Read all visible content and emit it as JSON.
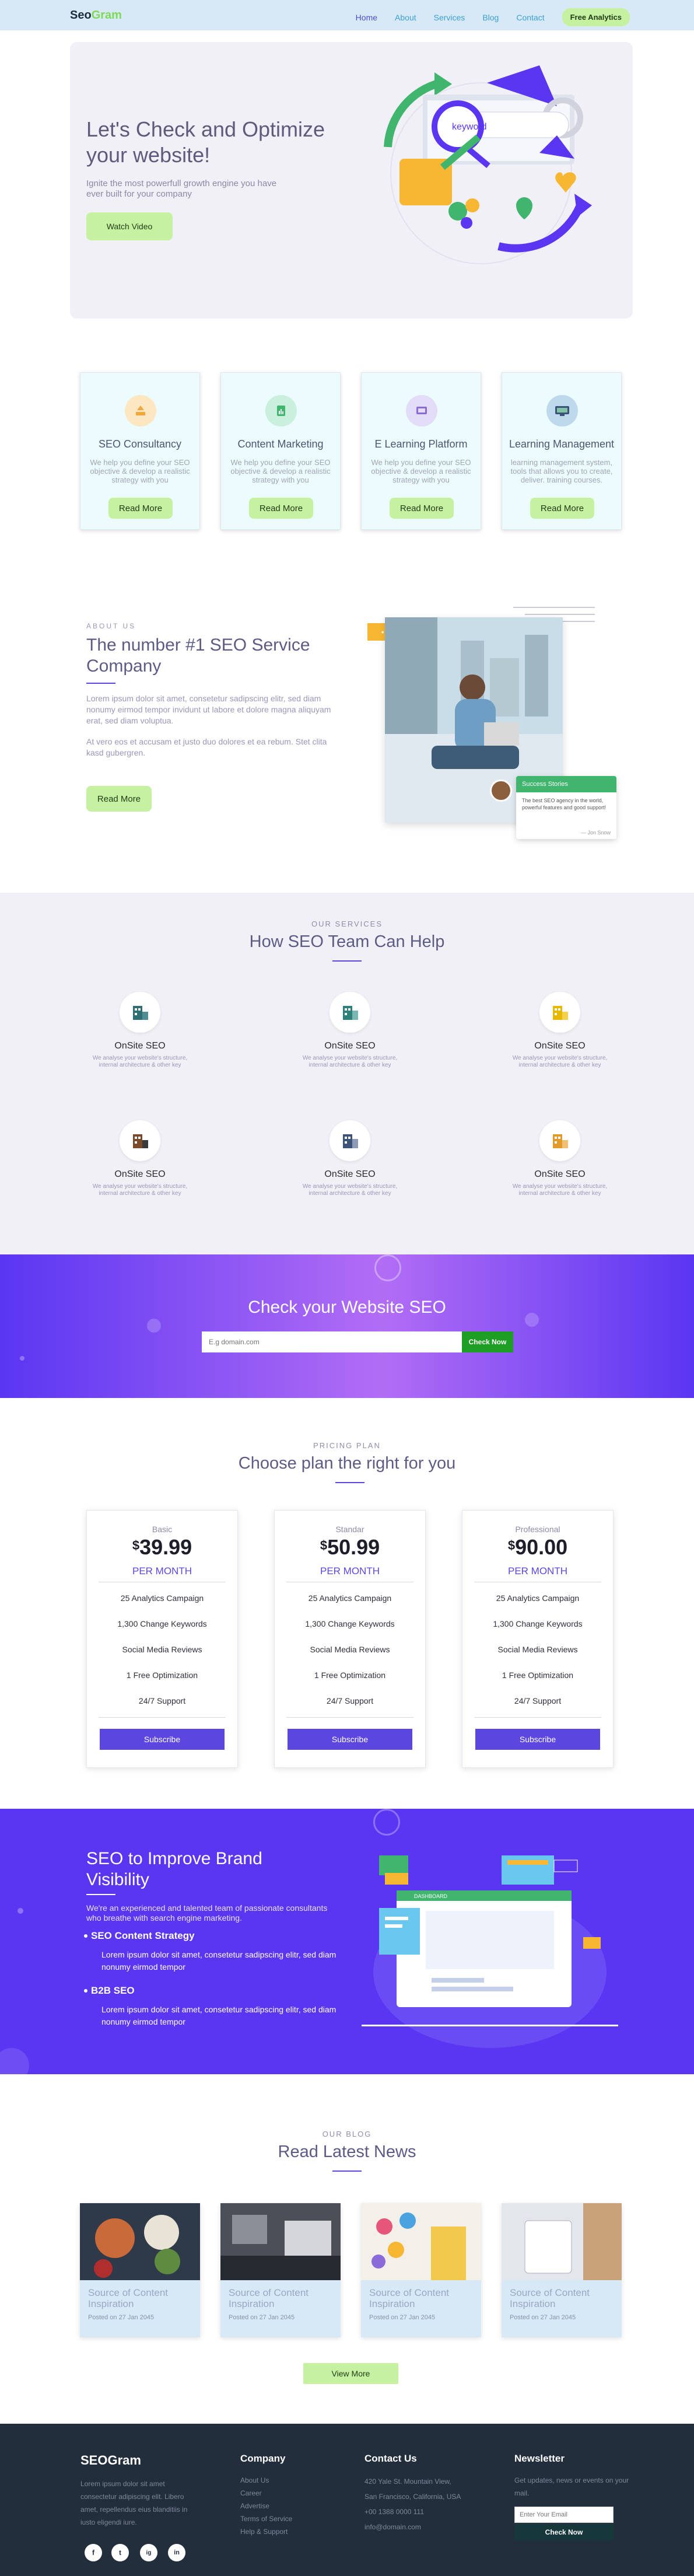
{
  "nav": {
    "brand_a": "Seo",
    "brand_b": "Gram",
    "links": [
      "Home",
      "About",
      "Services",
      "Blog",
      "Contact"
    ],
    "cta": "Free Analytics"
  },
  "hero": {
    "title": "Let's Check and Optimize your website!",
    "subtitle": "Ignite the most powerfull growth engine you have ever built for your company",
    "button": "Watch Video",
    "illustration_text": "keyword"
  },
  "services": [
    {
      "title": "SEO Consultancy",
      "text": "We help you define your SEO objective & develop a realistic strategy with you",
      "button": "Read More",
      "icon": "upload-icon",
      "color": "#fde6c2"
    },
    {
      "title": "Content Marketing",
      "text": "We help you define your SEO objective & develop a realistic strategy with you",
      "button": "Read More",
      "icon": "document-chart-icon",
      "color": "#c8f0dc"
    },
    {
      "title": "E Learning Platform",
      "text": "We help you define your SEO objective & develop a realistic strategy with you",
      "button": "Read More",
      "icon": "screen-icon",
      "color": "#e2dcf8"
    },
    {
      "title": "Learning Management",
      "text": "learning management system, tools that allows you to create, deliver. training courses.",
      "button": "Read More",
      "icon": "monitor-icon",
      "color": "#bfd9ec"
    }
  ],
  "about": {
    "label": "ABOUT US",
    "title": "The number #1 SEO Service Company",
    "p1": "Lorem ipsum dolor sit amet, consetetur sadipscing elitr, sed diam nonumy eirmod tempor invidunt ut labore et dolore magna aliquyam erat, sed diam voluptua.",
    "p2": "At vero eos et accusam et justo duo dolores et ea rebum. Stet clita kasd gubergren.",
    "button": "Read More",
    "badge_dots": "• • •",
    "testimonial_title": "Success Stories",
    "testimonial_text": "The best SEO agency in the world, powerful features and good support!",
    "testimonial_author": "— Jon Snow"
  },
  "team": {
    "label": "OUR SERVICES",
    "title": "How SEO Team Can Help",
    "items": [
      {
        "title": "OnSite SEO",
        "text": "We analyse your website's structure, internal architecture & other key",
        "color": "#2f6f73"
      },
      {
        "title": "OnSite SEO",
        "text": "We analyse your website's structure, internal architecture & other key",
        "color": "#2f7f7a"
      },
      {
        "title": "OnSite SEO",
        "text": "We analyse your website's structure, internal architecture & other key",
        "color": "#e6b800"
      },
      {
        "title": "OnSite SEO",
        "text": "We analyse your website's structure, internal architecture & other key",
        "color": "#7a4a2b"
      },
      {
        "title": "OnSite SEO",
        "text": "We analyse your website's structure, internal architecture & other key",
        "color": "#3d5277"
      },
      {
        "title": "OnSite SEO",
        "text": "We analyse your website's structure, internal architecture & other key",
        "color": "#e39a2c"
      }
    ]
  },
  "check": {
    "title": "Check your Website SEO",
    "placeholder": "E.g domain.com",
    "button": "Check Now"
  },
  "pricing": {
    "label": "PRICING PLAN",
    "title": "Choose plan the right for you",
    "plans": [
      {
        "name": "Basic",
        "currency": "$",
        "price": "39.99",
        "period": "PER MONTH",
        "button": "Subscribe"
      },
      {
        "name": "Standar",
        "currency": "$",
        "price": "50.99",
        "period": "PER MONTH",
        "button": "Subscribe"
      },
      {
        "name": "Professional",
        "currency": "$",
        "price": "90.00",
        "period": "PER MONTH",
        "button": "Subscribe"
      }
    ],
    "features": [
      "25 Analytics Campaign",
      "1,300 Change Keywords",
      "Social Media Reviews",
      "1 Free Optimization",
      "24/7 Support"
    ]
  },
  "brand": {
    "title": "SEO to Improve Brand Visibility",
    "desc": "We're an experienced and talented team of passionate consultants who breathe with search engine marketing.",
    "points": [
      {
        "title": "SEO Content Strategy",
        "text": "Lorem ipsum dolor sit amet, consetetur sadipscing elitr, sed diam nonumy eirmod tempor"
      },
      {
        "title": "B2B SEO",
        "text": "Lorem ipsum dolor sit amet, consetetur sadipscing elitr, sed diam nonumy eirmod tempor"
      }
    ],
    "window_header": "DASHBOARD"
  },
  "blog": {
    "label": "OUR BLOG",
    "title": "Read Latest News",
    "posts": [
      {
        "title": "Source of Content Inspiration",
        "date": "Posted on 27 Jan 2045"
      },
      {
        "title": "Source of Content Inspiration",
        "date": "Posted on 27 Jan 2045"
      },
      {
        "title": "Source of Content Inspiration",
        "date": "Posted on 27 Jan 2045"
      },
      {
        "title": "Source of Content Inspiration",
        "date": "Posted on 27 Jan 2045"
      }
    ],
    "button": "View More"
  },
  "footer": {
    "brand": "SEOGram",
    "about": "Lorem ipsum dolor sit amet consectetur adipiscing elit. Libero amet, repellendus eius blanditiis in iusto eligendi iure.",
    "company_title": "Company",
    "company_links": [
      "About Us",
      "Career",
      "Advertise",
      "Terms of Service",
      "Help & Support"
    ],
    "contact_title": "Contact Us",
    "contact_lines": [
      "420 Yale St. Mountain View,",
      "San Francisco, California, USA",
      "+00 1388 0000 111",
      "info@domain.com"
    ],
    "news_title": "Newsletter",
    "news_text": "Get updates, news or events on your mail.",
    "news_placeholder": "Enter Your Email",
    "news_button": "Check Now",
    "social": [
      "f",
      "t",
      "ig",
      "in"
    ]
  }
}
